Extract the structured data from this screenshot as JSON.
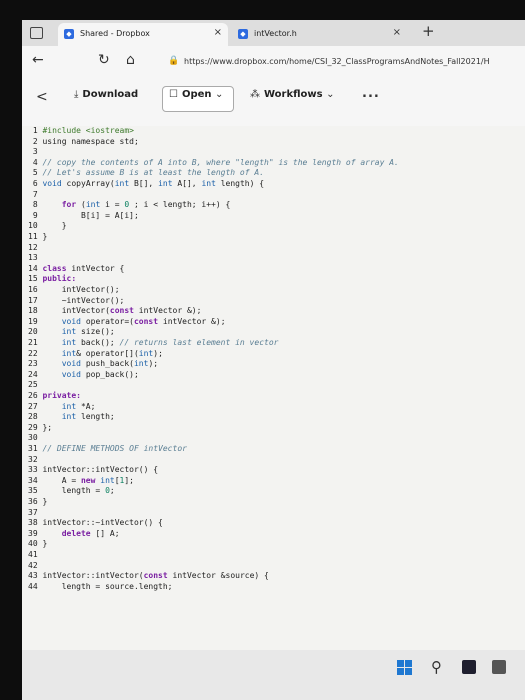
{
  "browser": {
    "tabs": [
      {
        "title": "Shared - Dropbox",
        "active": true,
        "close": "×"
      },
      {
        "title": "intVector.h",
        "active": false,
        "close": "×"
      }
    ],
    "new_tab": "+",
    "url": "https://www.dropbox.com/home/CSI_32_ClassProgramsAndNotes_Fall2021/H"
  },
  "toolbar": {
    "back": "<",
    "download_label": "Download",
    "open_label": "Open",
    "workflows_label": "Workflows",
    "more": "..."
  },
  "code_lines": [
    {
      "n": "1",
      "parts": [
        [
          "pp",
          "#include <iostream>"
        ]
      ]
    },
    {
      "n": "2",
      "parts": [
        [
          "",
          "using namespace std;"
        ]
      ]
    },
    {
      "n": "3",
      "parts": [
        [
          "",
          ""
        ]
      ]
    },
    {
      "n": "4",
      "parts": [
        [
          "cm",
          "// copy the contents of A into B, where \"length\" is the length of array A."
        ]
      ]
    },
    {
      "n": "5",
      "parts": [
        [
          "cm",
          "// Let's assume B is at least the length of A."
        ]
      ]
    },
    {
      "n": "6",
      "parts": [
        [
          "ty",
          "void "
        ],
        [
          "",
          "copyArray("
        ],
        [
          "ty",
          "int "
        ],
        [
          "",
          "B[], "
        ],
        [
          "ty",
          "int "
        ],
        [
          "",
          "A[], "
        ],
        [
          "ty",
          "int "
        ],
        [
          "",
          "length) {"
        ]
      ]
    },
    {
      "n": "7",
      "parts": [
        [
          "",
          ""
        ]
      ]
    },
    {
      "n": "8",
      "parts": [
        [
          "kw",
          "    for "
        ],
        [
          "",
          "("
        ],
        [
          "ty",
          "int "
        ],
        [
          "",
          "i = "
        ],
        [
          "num",
          "0"
        ],
        [
          "",
          " ; i < length; i++) {"
        ]
      ]
    },
    {
      "n": "9",
      "parts": [
        [
          "",
          "        B[i] = A[i];"
        ]
      ]
    },
    {
      "n": "10",
      "parts": [
        [
          "",
          "    }"
        ]
      ]
    },
    {
      "n": "11",
      "parts": [
        [
          "",
          "}"
        ]
      ]
    },
    {
      "n": "12",
      "parts": [
        [
          "",
          ""
        ]
      ]
    },
    {
      "n": "13",
      "parts": [
        [
          "",
          ""
        ]
      ]
    },
    {
      "n": "14",
      "parts": [
        [
          "kw",
          "class "
        ],
        [
          "",
          "intVector {"
        ]
      ]
    },
    {
      "n": "15",
      "parts": [
        [
          "kw",
          "public:"
        ]
      ]
    },
    {
      "n": "16",
      "parts": [
        [
          "",
          "    intVector();"
        ]
      ]
    },
    {
      "n": "17",
      "parts": [
        [
          "",
          "    ~intVector();"
        ]
      ]
    },
    {
      "n": "18",
      "parts": [
        [
          "",
          "    intVector("
        ],
        [
          "kw",
          "const "
        ],
        [
          "",
          "intVector &);"
        ]
      ]
    },
    {
      "n": "19",
      "parts": [
        [
          "ty",
          "    void "
        ],
        [
          "",
          "operator=("
        ],
        [
          "kw",
          "const "
        ],
        [
          "",
          "intVector &);"
        ]
      ]
    },
    {
      "n": "20",
      "parts": [
        [
          "ty",
          "    int "
        ],
        [
          "",
          "size();"
        ]
      ]
    },
    {
      "n": "21",
      "parts": [
        [
          "ty",
          "    int "
        ],
        [
          "",
          "back(); "
        ],
        [
          "cm",
          "// returns last element in vector"
        ]
      ]
    },
    {
      "n": "22",
      "parts": [
        [
          "ty",
          "    int"
        ],
        [
          "",
          "& operator[]("
        ],
        [
          "ty",
          "int"
        ],
        [
          "",
          ");"
        ]
      ]
    },
    {
      "n": "23",
      "parts": [
        [
          "ty",
          "    void "
        ],
        [
          "",
          "push_back("
        ],
        [
          "ty",
          "int"
        ],
        [
          "",
          ");"
        ]
      ]
    },
    {
      "n": "24",
      "parts": [
        [
          "ty",
          "    void "
        ],
        [
          "",
          "pop_back();"
        ]
      ]
    },
    {
      "n": "25",
      "parts": [
        [
          "",
          ""
        ]
      ]
    },
    {
      "n": "26",
      "parts": [
        [
          "kw",
          "private:"
        ]
      ]
    },
    {
      "n": "27",
      "parts": [
        [
          "ty",
          "    int "
        ],
        [
          "",
          "*A;"
        ]
      ]
    },
    {
      "n": "28",
      "parts": [
        [
          "ty",
          "    int "
        ],
        [
          "",
          "length;"
        ]
      ]
    },
    {
      "n": "29",
      "parts": [
        [
          "",
          "};"
        ]
      ]
    },
    {
      "n": "30",
      "parts": [
        [
          "",
          ""
        ]
      ]
    },
    {
      "n": "31",
      "parts": [
        [
          "cm",
          "// DEFINE METHODS OF intVector"
        ]
      ]
    },
    {
      "n": "32",
      "parts": [
        [
          "",
          ""
        ]
      ]
    },
    {
      "n": "33",
      "parts": [
        [
          "",
          "intVector::intVector() {"
        ]
      ]
    },
    {
      "n": "34",
      "parts": [
        [
          "",
          "    A = "
        ],
        [
          "kw",
          "new "
        ],
        [
          "ty",
          "int"
        ],
        [
          "",
          "["
        ],
        [
          "num",
          "1"
        ],
        [
          "",
          "];"
        ]
      ]
    },
    {
      "n": "35",
      "parts": [
        [
          "",
          "    length = "
        ],
        [
          "num",
          "0"
        ],
        [
          "",
          ";"
        ]
      ]
    },
    {
      "n": "36",
      "parts": [
        [
          "",
          "}"
        ]
      ]
    },
    {
      "n": "37",
      "parts": [
        [
          "",
          ""
        ]
      ]
    },
    {
      "n": "38",
      "parts": [
        [
          "",
          "intVector::~intVector() {"
        ]
      ]
    },
    {
      "n": "39",
      "parts": [
        [
          "kw",
          "    delete "
        ],
        [
          "",
          "[] A;"
        ]
      ]
    },
    {
      "n": "40",
      "parts": [
        [
          "",
          "}"
        ]
      ]
    },
    {
      "n": "41",
      "parts": [
        [
          "",
          ""
        ]
      ]
    },
    {
      "n": "42",
      "parts": [
        [
          "",
          ""
        ]
      ]
    },
    {
      "n": "43",
      "parts": [
        [
          "",
          "intVector::intVector("
        ],
        [
          "kw",
          "const "
        ],
        [
          "",
          "intVector &source) {"
        ]
      ]
    },
    {
      "n": "44",
      "parts": [
        [
          "",
          "    length = source.length;"
        ]
      ]
    }
  ],
  "colors": {
    "keyword": "#7a1fa2",
    "comment": "#5a7e93",
    "type": "#1a5fa8",
    "number": "#0a8060"
  },
  "taskbar": {
    "icons": [
      "windows-start-icon",
      "search-icon",
      "terminal-icon",
      "app-icon"
    ]
  }
}
